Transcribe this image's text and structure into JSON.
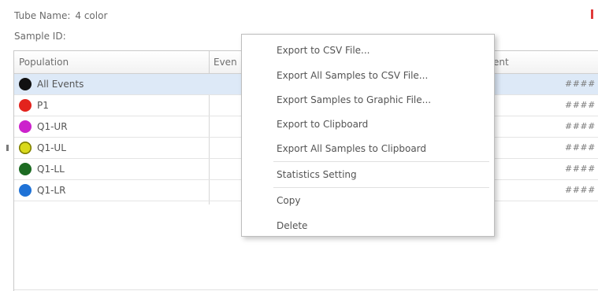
{
  "header": {
    "tube_name_label": "Tube Name:",
    "tube_name_value": "4 color",
    "sample_id_label": "Sample ID:",
    "sample_id_value": ""
  },
  "table": {
    "columns": [
      "Population",
      "Even",
      "arent"
    ],
    "rows": [
      {
        "label": "All Events",
        "color": "#111111",
        "value": "####",
        "selected": true
      },
      {
        "label": "P1",
        "color": "#e3231d",
        "value": "####",
        "selected": false
      },
      {
        "label": "Q1-UR",
        "color": "#cc22cc",
        "value": "####",
        "selected": false
      },
      {
        "label": "Q1-UL",
        "color": "#d9d91c",
        "value": "####",
        "selected": false
      },
      {
        "label": "Q1-LL",
        "color": "#1d6b22",
        "value": "####",
        "selected": false
      },
      {
        "label": "Q1-LR",
        "color": "#1f72d6",
        "value": "####",
        "selected": false
      }
    ]
  },
  "context_menu": {
    "items": [
      "Export to CSV File...",
      "Export All Samples to CSV File...",
      "Export Samples to Graphic File...",
      "Export to Clipboard",
      "Export All Samples to Clipboard",
      "Statistics Setting",
      "Copy",
      "Delete"
    ]
  },
  "colors": {
    "selection": "#dde9f7",
    "accent_marker": "#e03a3a"
  }
}
